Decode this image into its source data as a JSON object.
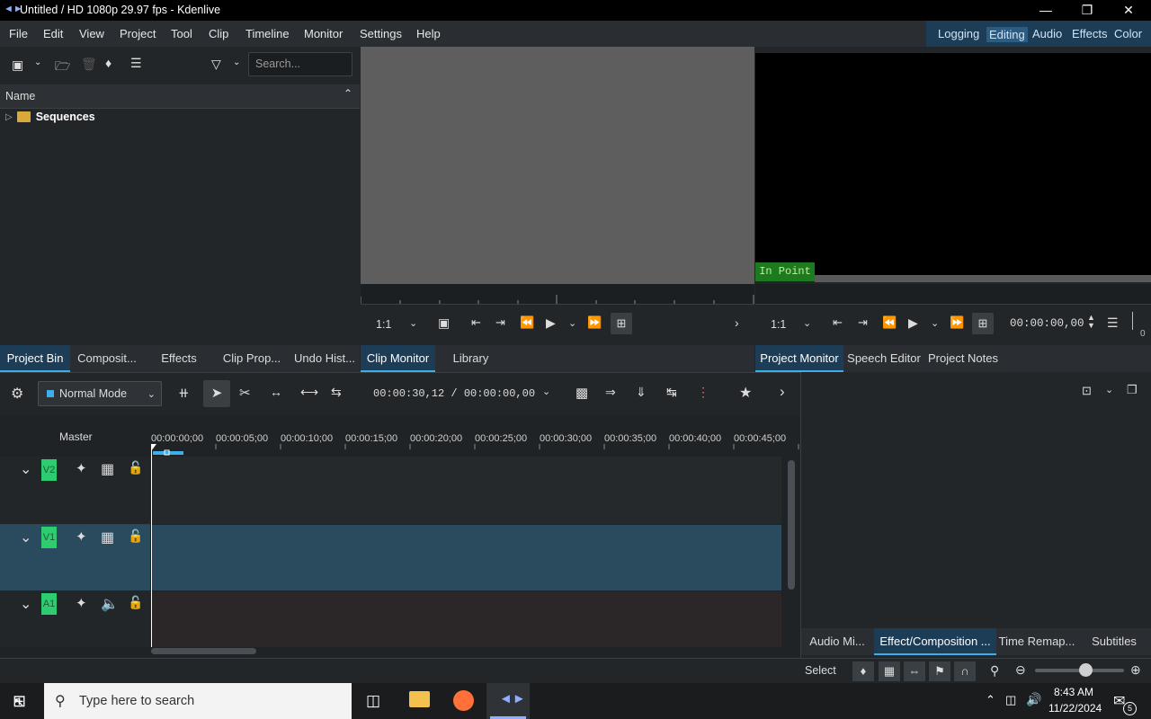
{
  "window": {
    "title": "Untitled / HD 1080p 29.97 fps - Kdenlive"
  },
  "menu": [
    "File",
    "Edit",
    "View",
    "Project",
    "Tool",
    "Clip",
    "Timeline",
    "Monitor",
    "Settings",
    "Help"
  ],
  "layouts": [
    "Logging",
    "Editing",
    "Audio",
    "Effects",
    "Color"
  ],
  "layouts_active": "Editing",
  "bin": {
    "search_placeholder": "Search...",
    "column_name": "Name",
    "items": [
      {
        "label": "Sequences"
      }
    ]
  },
  "left_tabs": [
    "Project Bin",
    "Composit...",
    "Effects",
    "Clip Prop...",
    "Undo Hist..."
  ],
  "clip_monitor": {
    "zoom": "1:1"
  },
  "clip_tabs": [
    "Clip Monitor",
    "Library"
  ],
  "project_monitor": {
    "overlay": "In Point",
    "zoom": "1:1",
    "timecode": "00:00:00,00",
    "side_value": "0"
  },
  "proj_tabs": [
    "Project Monitor",
    "Speech Editor",
    "Project Notes"
  ],
  "timeline": {
    "mode": "Normal Mode",
    "timecode": "00:00:30,12 / 00:00:00,00",
    "master_label": "Master",
    "ruler_ticks": [
      "00:00:00;00",
      "00:00:05;00",
      "00:00:10;00",
      "00:00:15;00",
      "00:00:20;00",
      "00:00:25;00",
      "00:00:30;00",
      "00:00:35;00",
      "00:00:40;00",
      "00:00:45;00"
    ],
    "tracks": [
      {
        "name": "V2"
      },
      {
        "name": "V1"
      },
      {
        "name": "A1"
      }
    ]
  },
  "right_tabs": [
    "Audio Mi...",
    "Effect/Composition ...",
    "Time Remap...",
    "Subtitles"
  ],
  "status": {
    "tool": "Select"
  },
  "taskbar": {
    "search_placeholder": "Type here to search",
    "time": "8:43 AM",
    "date": "11/22/2024",
    "notifications": "5"
  },
  "colors": {
    "accent": "#3daee9",
    "track_tag": "#2ecc71",
    "in_point_bg": "#1e7a1e",
    "selected_track": "#2a4a5e"
  }
}
